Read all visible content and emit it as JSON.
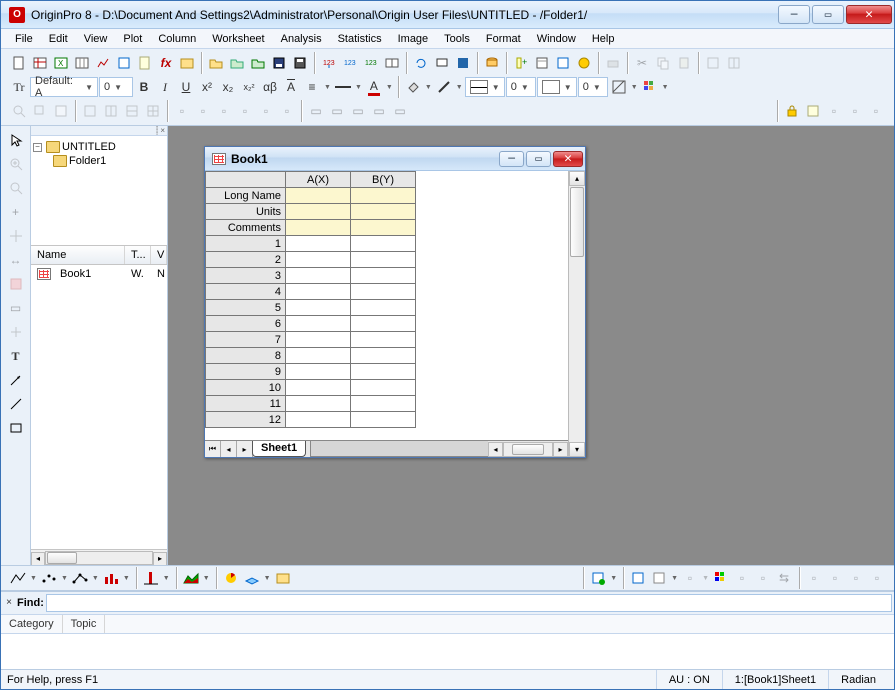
{
  "window": {
    "app_name": "OriginPro 8",
    "title": "OriginPro 8 - D:\\Document And Settings2\\Administrator\\Personal\\Origin User Files\\UNTITLED - /Folder1/"
  },
  "menu": [
    "File",
    "Edit",
    "View",
    "Plot",
    "Column",
    "Worksheet",
    "Analysis",
    "Statistics",
    "Image",
    "Tools",
    "Format",
    "Window",
    "Help"
  ],
  "format_bar": {
    "style_label_icon": "Tr",
    "style_value": "Default: A",
    "size_value": "0"
  },
  "toolbar_icons": {
    "row1": [
      "new-blank",
      "new-worksheet",
      "new-excel",
      "new-matrix",
      "new-graph",
      "new-layout",
      "new-notes",
      "new-function",
      "new-project",
      "open",
      "open-template",
      "open-excel",
      "save",
      "save-template",
      "import-single",
      "import-multi",
      "import-wizard",
      "batch",
      "refresh",
      "slide",
      "recalc",
      "db-import",
      "add-column",
      "results-log",
      "code-builder",
      "recompile",
      "print"
    ],
    "row2_fmt": [
      "bold",
      "italic",
      "underline",
      "superscript",
      "subscript",
      "supersub",
      "greek",
      "font-inc",
      "align-left",
      "align-center",
      "line-style",
      "font-color"
    ],
    "row2_right": [
      "fill-color",
      "line-color",
      "line-swatch",
      "line-w",
      "border-swatch",
      "border-w",
      "pattern",
      "palette"
    ],
    "row3_left": [
      "rescale",
      "zoom-rect",
      "read-coord",
      "data-reader",
      "layout-1",
      "layout-2",
      "layout-3",
      "panels-1",
      "panels-2",
      "panels-3",
      "panels-4",
      "panels-5",
      "panels-6",
      "stack-1",
      "stack-2",
      "stack-3",
      "stack-4",
      "stack-5"
    ],
    "row3_right": [
      "lock",
      "notes-y",
      "copy-fmt",
      "paste-fmt",
      "duplicate"
    ]
  },
  "vtool": [
    "pointer",
    "zoom-in",
    "zoom-out",
    "reader",
    "screen-reader",
    "data-selector",
    "mask",
    "draw-data",
    "text-tool",
    "arrow-tool",
    "line-tool",
    "rect-tool"
  ],
  "explorer": {
    "root": "UNTITLED",
    "children": [
      "Folder1"
    ],
    "cols": [
      "Name",
      "T...",
      "V"
    ],
    "rows": [
      {
        "name": "Book1",
        "t": "W.",
        "v": "N"
      }
    ]
  },
  "book": {
    "title": "Book1",
    "cols": [
      "A(X)",
      "B(Y)"
    ],
    "meta_rows": [
      "Long Name",
      "Units",
      "Comments"
    ],
    "row_count": 12,
    "sheet_tab": "Sheet1"
  },
  "plot_bar": {
    "left": [
      "line",
      "scatter",
      "line-scatter",
      "dropdown1",
      "column",
      "dropdown2",
      "bar",
      "area",
      "3d-bars",
      "dropdown3",
      "pie",
      "contour",
      "surface",
      "template"
    ],
    "right": [
      "new-layer",
      "add-axis",
      "extract",
      "merge",
      "dropdown4",
      "layer1",
      "layer2",
      "rgb",
      "layer3",
      "layer4",
      "swap",
      "group",
      "ungroup",
      "front",
      "back"
    ]
  },
  "find": {
    "label": "Find:",
    "placeholder": "",
    "tabs": [
      "Category",
      "Topic"
    ]
  },
  "status": {
    "help": "For Help, press F1",
    "au": "AU : ON",
    "sheet": "1:[Book1]Sheet1",
    "angle": "Radian"
  },
  "colors": {
    "accent": "#3972b6",
    "close": "#d83a3a",
    "meta_bg": "#fcf7cf"
  }
}
